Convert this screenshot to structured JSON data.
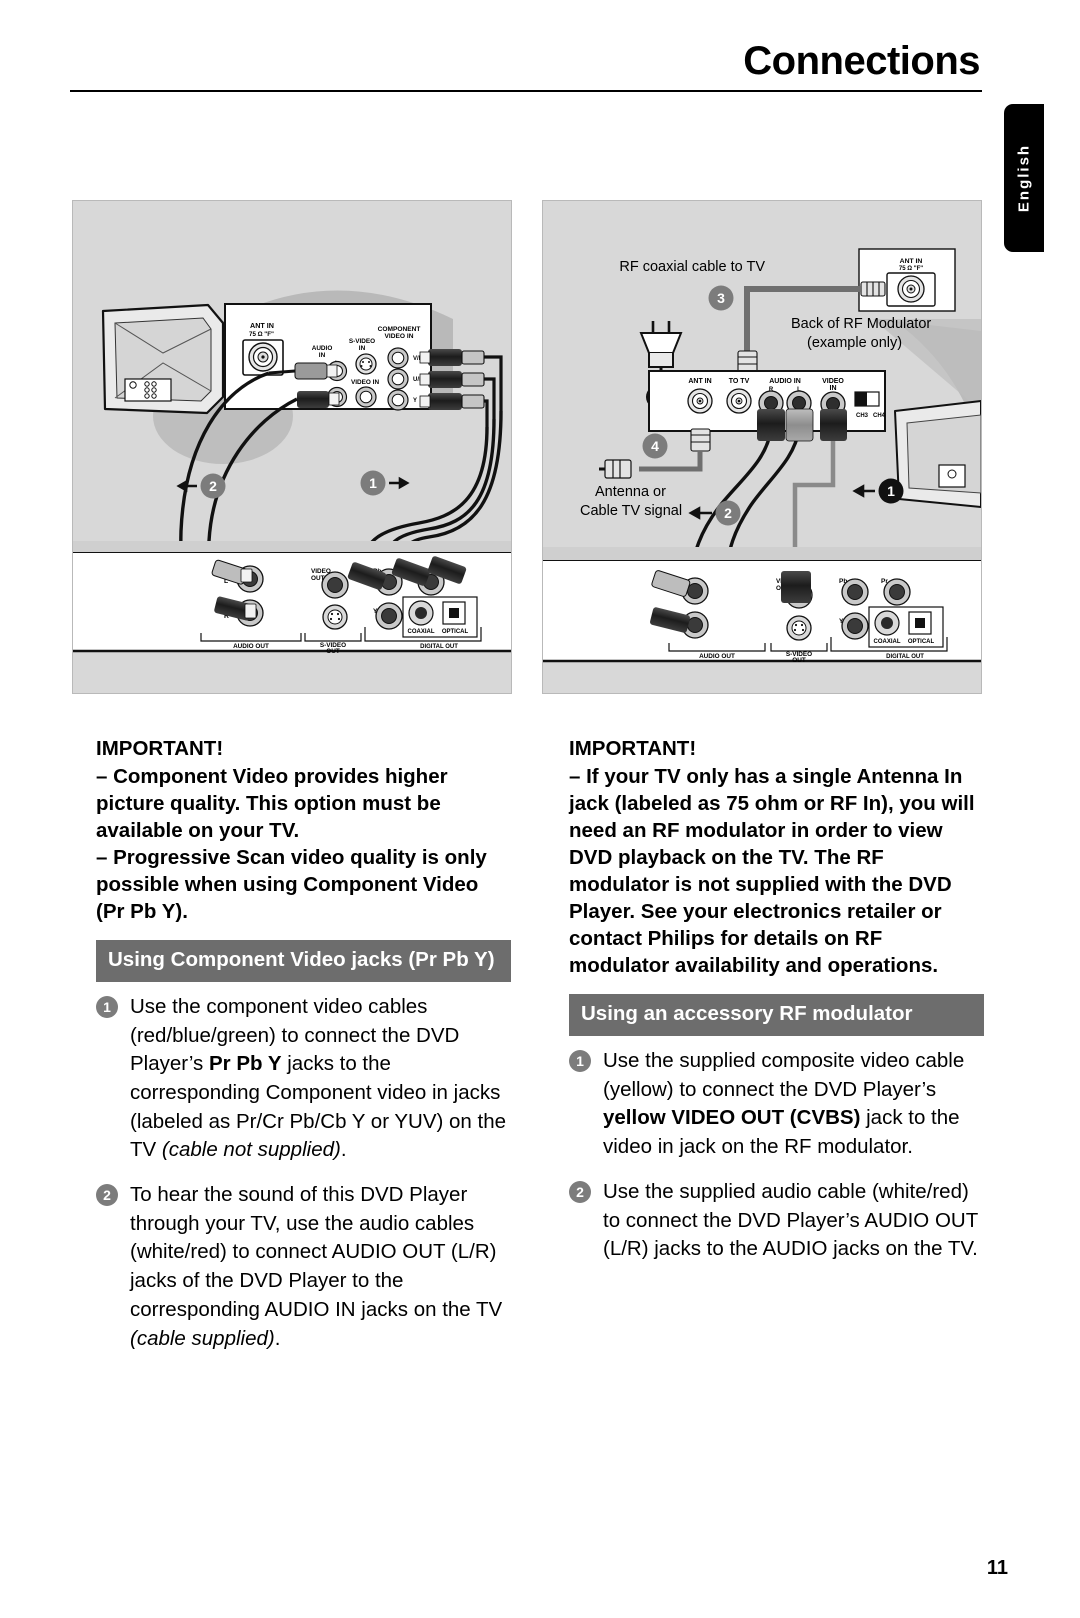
{
  "header": {
    "title": "Connections"
  },
  "lang_tab": {
    "label": "English"
  },
  "page_number": "11",
  "colors": {
    "figure_bg": "#d8d8d8",
    "section_bar": "#6d6d6d",
    "step_badge": "#7c7c7c",
    "cable_gray": "#8a8a8a",
    "accent_black": "#000000"
  },
  "figures": {
    "left": {
      "name": "component-video-connection-diagram",
      "tv_panel": {
        "ant_in": "ANT IN",
        "ant_in_sub": "75 Ω \"F\"",
        "audio_in": "AUDIO IN",
        "audio_l": "L",
        "audio_r": "R",
        "s_video_in": "S-VIDEO IN",
        "video_in": "VIDEO IN",
        "component_video_in": "COMPONENT VIDEO IN",
        "jack_pr": "V/Pr/Cr",
        "jack_pb": "U/Pb/Cb",
        "jack_y": "Y"
      },
      "dvd_panel": {
        "audio_out": "AUDIO OUT",
        "audio_l": "L",
        "audio_r": "R",
        "s_video_out": "S-VIDEO OUT",
        "video_out": "VIDEO OUT",
        "jack_pb": "Pb",
        "jack_pr": "Pr",
        "jack_y": "Y",
        "coaxial": "COAXIAL",
        "optical": "OPTICAL",
        "digital_out": "DIGITAL OUT"
      },
      "markers": [
        "1",
        "2"
      ]
    },
    "right": {
      "name": "rf-modulator-connection-diagram",
      "callouts": {
        "rf_coaxial": "RF coaxial cable to TV",
        "back_of_rf_1": "Back of RF Modulator",
        "back_of_rf_2": "(example only)",
        "antenna_1": "Antenna or",
        "antenna_2": "Cable TV signal"
      },
      "tv_ant": {
        "ant_in": "ANT IN",
        "ant_in_sub": "75 Ω \"F\""
      },
      "modulator_panel": {
        "ant_in": "ANT IN",
        "to_tv": "TO TV",
        "audio_in": "AUDIO IN",
        "audio_r": "R",
        "audio_l": "L",
        "video_in": "VIDEO IN",
        "ch3": "CH3",
        "ch4": "CH4"
      },
      "dvd_panel": {
        "audio_out": "AUDIO OUT",
        "audio_l": "L",
        "audio_r": "R",
        "s_video_out": "S-VIDEO OUT",
        "video_out": "VIDEO OUT",
        "jack_pb": "Pb",
        "jack_pr": "Pr",
        "jack_y": "Y",
        "coaxial": "COAXIAL",
        "optical": "OPTICAL",
        "digital_out": "DIGITAL OUT"
      },
      "markers": [
        "1",
        "2",
        "3",
        "4"
      ]
    }
  },
  "left_column": {
    "important_title": "IMPORTANT!",
    "important_lines": [
      "–  Component  Video provides higher picture quality.  This option must be available on your TV.",
      "–   Progressive Scan video quality is only possible when using Component Video (Pr Pb Y)."
    ],
    "section_heading": "Using Component Video jacks (Pr Pb Y)",
    "steps": [
      {
        "num": "1",
        "parts": [
          {
            "t": "Use the component video cables (red/blue/green) to connect the DVD Player’s ",
            "s": "n"
          },
          {
            "t": "Pr Pb Y",
            "s": "b"
          },
          {
            "t": " jacks to the corresponding Component video in jacks (labeled as Pr/Cr Pb/Cb Y or YUV) on the TV ",
            "s": "n"
          },
          {
            "t": "(cable not supplied)",
            "s": "i"
          },
          {
            "t": ".",
            "s": "n"
          }
        ]
      },
      {
        "num": "2",
        "parts": [
          {
            "t": "To hear the sound of this DVD Player through your TV, use the audio cables (white/red) to connect AUDIO OUT (L/R) jacks of the DVD Player to the corresponding AUDIO IN jacks on the TV ",
            "s": "n"
          },
          {
            "t": "(cable supplied)",
            "s": "i"
          },
          {
            "t": ".",
            "s": "n"
          }
        ]
      }
    ]
  },
  "right_column": {
    "important_title": "IMPORTANT!",
    "important_lines": [
      "–  If your TV only has a single Antenna In jack (labeled as 75 ohm or RF In),  you will need an RF modulator in order to view DVD playback on the TV.  The RF modulator is not supplied with the DVD Player. See your electronics retailer or contact Philips for details on RF modulator availability and operations."
    ],
    "section_heading": "Using an accessory RF modulator",
    "steps": [
      {
        "num": "1",
        "parts": [
          {
            "t": "Use the supplied composite video cable (yellow) to connect the DVD Player’s ",
            "s": "n"
          },
          {
            "t": "yellow VIDEO OUT (CVBS)",
            "s": "b"
          },
          {
            "t": " jack to the video in jack on the RF modulator.",
            "s": "n"
          }
        ]
      },
      {
        "num": "2",
        "parts": [
          {
            "t": "Use the supplied audio cable (white/red) to connect the DVD Player’s AUDIO OUT (L/R) jacks to the AUDIO jacks on the TV.",
            "s": "n"
          }
        ]
      }
    ]
  }
}
